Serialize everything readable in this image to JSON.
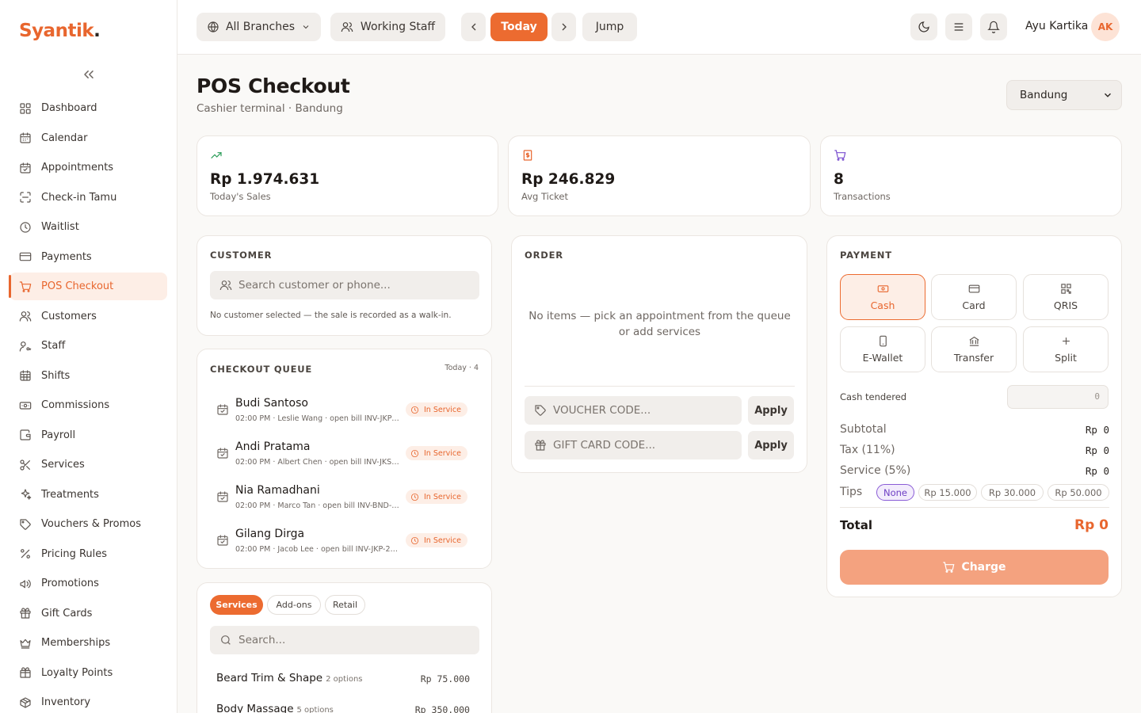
{
  "brand": {
    "name": "Syantik",
    "dot": "."
  },
  "sidebar": {
    "items": [
      {
        "label": "Dashboard",
        "icon": "grid-icon"
      },
      {
        "label": "Calendar",
        "icon": "calendar-icon"
      },
      {
        "label": "Appointments",
        "icon": "calendar-check-icon"
      },
      {
        "label": "Check-in Tamu",
        "icon": "scan-icon"
      },
      {
        "label": "Waitlist",
        "icon": "clock-icon"
      },
      {
        "label": "Payments",
        "icon": "credit-card-icon"
      },
      {
        "label": "POS Checkout",
        "icon": "cart-icon",
        "active": true
      },
      {
        "label": "Customers",
        "icon": "users-icon"
      },
      {
        "label": "Staff",
        "icon": "user-key-icon"
      },
      {
        "label": "Shifts",
        "icon": "calendar-grid-icon"
      },
      {
        "label": "Commissions",
        "icon": "banknote-icon"
      },
      {
        "label": "Payroll",
        "icon": "wallet-icon"
      },
      {
        "label": "Services",
        "icon": "scissors-icon"
      },
      {
        "label": "Treatments",
        "icon": "sparkles-icon"
      },
      {
        "label": "Vouchers & Promos",
        "icon": "tag-icon"
      },
      {
        "label": "Pricing Rules",
        "icon": "percent-icon"
      },
      {
        "label": "Promotions",
        "icon": "megaphone-icon"
      },
      {
        "label": "Gift Cards",
        "icon": "gift-icon"
      },
      {
        "label": "Memberships",
        "icon": "crown-icon"
      },
      {
        "label": "Loyalty Points",
        "icon": "gift-box-icon"
      },
      {
        "label": "Inventory",
        "icon": "package-icon"
      }
    ]
  },
  "topbar": {
    "branches_label": "All Branches",
    "staff_label": "Working Staff",
    "today_label": "Today",
    "jump_label": "Jump",
    "user_name": "Ayu Kartika",
    "user_initials": "AK"
  },
  "page": {
    "title": "POS Checkout",
    "subtitle": "Cashier terminal · Bandung",
    "branch_selected": "Bandung"
  },
  "stats": [
    {
      "value": "Rp 1.974.631",
      "label": "Today's Sales",
      "icon": "trending-up-icon",
      "color": "#2e9e5b"
    },
    {
      "value": "Rp 246.829",
      "label": "Avg Ticket",
      "icon": "receipt-icon",
      "color": "#e8662e"
    },
    {
      "value": "8",
      "label": "Transactions",
      "icon": "cart-icon",
      "color": "#7a4fd0"
    }
  ],
  "customer": {
    "title": "CUSTOMER",
    "placeholder": "Search customer or phone...",
    "note": "No customer selected — the sale is recorded as a walk-in."
  },
  "queue": {
    "title": "CHECKOUT QUEUE",
    "count_label": "Today · 4",
    "items": [
      {
        "name": "Budi Santoso",
        "meta": "02:00 PM · Leslie Wang · open bill INV-JKP-…",
        "status": "In Service"
      },
      {
        "name": "Andi Pratama",
        "meta": "02:00 PM · Albert Chen · open bill INV-JKS-…",
        "status": "In Service"
      },
      {
        "name": "Nia Ramadhani",
        "meta": "02:00 PM · Marco Tan · open bill INV-BND-2…",
        "status": "In Service"
      },
      {
        "name": "Gilang Dirga",
        "meta": "02:00 PM · Jacob Lee · open bill INV-JKP-2…",
        "status": "In Service"
      }
    ]
  },
  "catalog": {
    "tabs": [
      "Services",
      "Add-ons",
      "Retail"
    ],
    "search_placeholder": "Search...",
    "items": [
      {
        "name": "Beard Trim & Shape",
        "options": "2 options",
        "price": "Rp 75.000"
      },
      {
        "name": "Body Massage",
        "options": "5 options",
        "price": "Rp 350.000"
      }
    ]
  },
  "order": {
    "title": "ORDER",
    "empty_text": "No items — pick an appointment from the queue or add services",
    "voucher_placeholder": "VOUCHER CODE...",
    "giftcard_placeholder": "GIFT CARD CODE...",
    "apply_label": "Apply"
  },
  "payment": {
    "title": "PAYMENT",
    "methods": [
      {
        "label": "Cash",
        "icon": "cash-icon",
        "active": true
      },
      {
        "label": "Card",
        "icon": "card-icon"
      },
      {
        "label": "QRIS",
        "icon": "qr-icon"
      },
      {
        "label": "E-Wallet",
        "icon": "phone-icon"
      },
      {
        "label": "Transfer",
        "icon": "bank-icon"
      },
      {
        "label": "Split",
        "icon": "plus-icon"
      }
    ],
    "cash_tendered_label": "Cash tendered",
    "cash_tendered_placeholder": "0",
    "subtotal_label": "Subtotal",
    "subtotal_value": "Rp 0",
    "tax_label": "Tax (11%)",
    "tax_value": "Rp 0",
    "service_label": "Service (5%)",
    "service_value": "Rp 0",
    "tips_label": "Tips",
    "tips": [
      "None",
      "Rp 15.000",
      "Rp 30.000",
      "Rp 50.000"
    ],
    "total_label": "Total",
    "total_value": "Rp 0",
    "charge_label": "Charge"
  },
  "colors": {
    "accent": "#e8662e",
    "accent_light": "#fdeee6",
    "charge_disabled": "#f4a27f",
    "tip_active": "#8a5cd6"
  }
}
